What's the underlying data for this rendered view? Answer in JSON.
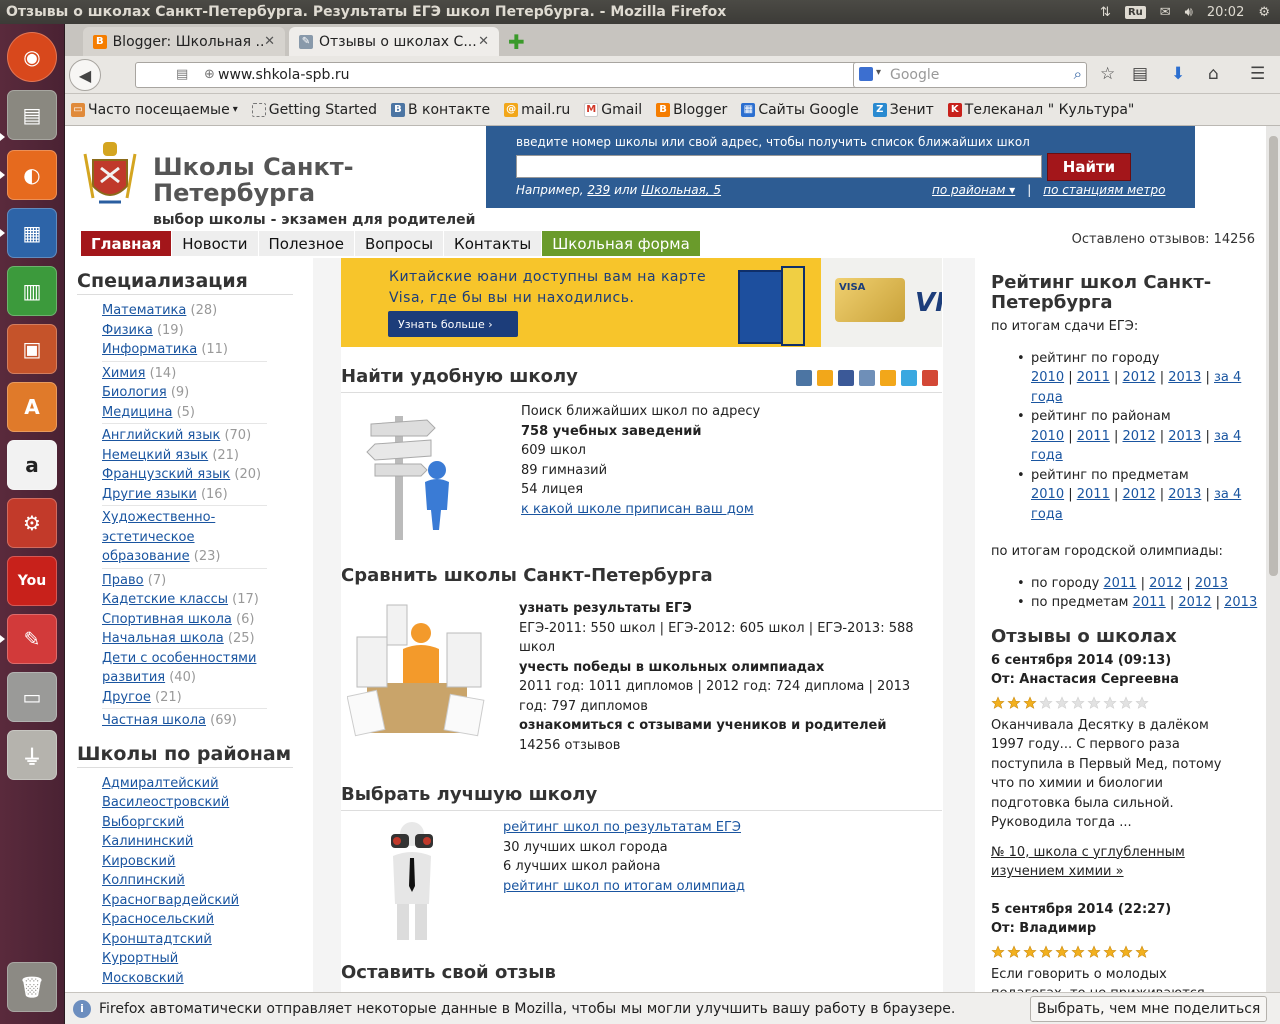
{
  "os": {
    "window_title": "Отзывы о школах Санкт-Петербурга. Результаты ЕГЭ школ Петербурга. - Mozilla Firefox",
    "keyboard_layout": "Ru",
    "clock": "20:02"
  },
  "browser": {
    "tabs": [
      {
        "label": "Blogger: Школьная ...",
        "active": false
      },
      {
        "label": "Отзывы о школах С...",
        "active": true
      }
    ],
    "url": "www.shkola-spb.ru",
    "search_placeholder": "Google",
    "bookmarks": [
      "Часто посещаемые",
      "Getting Started",
      "В контакте",
      "mail.ru",
      "Gmail",
      "Blogger",
      "Сайты Google",
      "Зенит",
      "Телеканал \" Культура\""
    ],
    "notification": "Firefox автоматически отправляет некоторые данные в Mozilla, чтобы мы могли улучшить вашу работу в браузере.",
    "notification_button": "Выбрать, чем мне поделиться"
  },
  "header": {
    "title": "Школы Санкт-Петербурга",
    "subtitle": "выбор школы - экзамен для родителей",
    "search_hint": "введите номер школы или свой адрес, чтобы получить список ближайших школ",
    "search_button": "Найти",
    "example_prefix": "Например,",
    "example_1": "239",
    "example_or": "или",
    "example_2": "Школьная, 5",
    "by_district": "по районам ▾",
    "by_metro": "по станциям метро",
    "divider": "|",
    "reviews_left": "Оставлено отзывов: 14256"
  },
  "menu": [
    "Главная",
    "Новости",
    "Полезное",
    "Вопросы",
    "Контакты",
    "Школьная форма"
  ],
  "left": {
    "spec_title": "Специализация",
    "spec": [
      {
        "name": "Математика",
        "count": "(28)"
      },
      {
        "name": "Физика",
        "count": "(19)"
      },
      {
        "name": "Информатика",
        "count": "(11)"
      },
      {
        "name": "Химия",
        "count": "(14)"
      },
      {
        "name": "Биология",
        "count": "(9)"
      },
      {
        "name": "Медицина",
        "count": "(5)"
      },
      {
        "name": "Английский язык",
        "count": "(70)"
      },
      {
        "name": "Немецкий язык",
        "count": "(21)"
      },
      {
        "name": "Французский язык",
        "count": "(20)"
      },
      {
        "name": "Другие языки",
        "count": "(16)"
      },
      {
        "name": "Художественно-эстетическое образование",
        "count": "(23)"
      },
      {
        "name": "Право",
        "count": "(7)"
      },
      {
        "name": "Кадетские классы",
        "count": "(17)"
      },
      {
        "name": "Спортивная школа",
        "count": "(6)"
      },
      {
        "name": "Начальная школа",
        "count": "(25)"
      },
      {
        "name": "Дети с особенностями развития",
        "count": "(40)"
      },
      {
        "name": "Другое",
        "count": "(21)"
      },
      {
        "name": "Частная школа",
        "count": "(69)"
      }
    ],
    "districts_title": "Школы по районам",
    "districts": [
      "Адмиралтейский",
      "Василеостровский",
      "Выборгский",
      "Калининский",
      "Кировский",
      "Колпинский",
      "Красногвардейский",
      "Красносельский",
      "Кронштадтский",
      "Курортный",
      "Московский"
    ]
  },
  "banner": {
    "text": "Китайские юани доступны вам на карте Visa, где бы вы ни находились.",
    "button": "Узнать больше  ›",
    "card_label": "VISA",
    "logo": "VI"
  },
  "center": {
    "find": {
      "title": "Найти удобную школу",
      "lines": [
        "Поиск ближайших школ по адресу",
        "758 учебных заведений",
        "609 школ",
        "89 гимназий",
        "54 лицея"
      ],
      "link": "к какой школе приписан ваш дом"
    },
    "compare": {
      "title": "Сравнить школы Санкт-Петербурга",
      "h1": "узнать результаты ЕГЭ",
      "t1": "ЕГЭ-2011: 550 школ | ЕГЭ-2012: 605 школ | ЕГЭ-2013: 588 школ",
      "h2": "учесть победы в школьных олимпиадах",
      "t2": "2011 год: 1011 дипломов | 2012 год: 724 диплома | 2013 год: 797 дипломов",
      "h3": "ознакомиться с отзывами учеников и родителей",
      "t3": "14256 отзывов"
    },
    "best": {
      "title": "Выбрать лучшую школу",
      "link1": "рейтинг школ по результатам ЕГЭ",
      "t1": "30 лучших школ города",
      "t2": "6 лучших школ района",
      "link2": "рейтинг школ по итогам олимпиад"
    },
    "review_title": "Оставить свой отзыв"
  },
  "right": {
    "rating_title": "Рейтинг школ Санкт-Петербурга",
    "by_ege": "по итогам сдачи ЕГЭ:",
    "ege_items": [
      "рейтинг по городу",
      "рейтинг по районам",
      "рейтинг по предметам"
    ],
    "years": [
      "2010",
      "2011",
      "2012",
      "2013",
      "за 4 года"
    ],
    "by_olymp": "по итогам городской олимпиады:",
    "olymp_city": "по городу",
    "olymp_subj": "по предметам",
    "olymp_years": [
      "2011",
      "2012",
      "2013"
    ],
    "reviews_title": "Отзывы о школах",
    "review1": {
      "date": "6 сентября 2014 (09:13)",
      "author": "От: Анастасия Сергеевна",
      "stars": 3,
      "text": "Оканчивала Десятку в далёком 1997 году... С первого раза поступила в Первый Мед, потому что по химии и биологии подготовка была сильной. Руководила тогда ...",
      "school": "№ 10, школа с углубленным изучением химии »"
    },
    "review2": {
      "date": "5 сентября 2014 (22:27)",
      "author": "От: Владимир",
      "stars": 10,
      "text": "Если говорить о молодых педагогах, то не приживаются некомпетентные, высокомерные, не умеющие ладить с детьми молодые специалисты. У сына в"
    }
  },
  "colors": {
    "accent_red": "#a3161a",
    "panel_blue": "#2d5c93",
    "menu_green": "#6a9b2b",
    "link": "#1a55a0"
  }
}
